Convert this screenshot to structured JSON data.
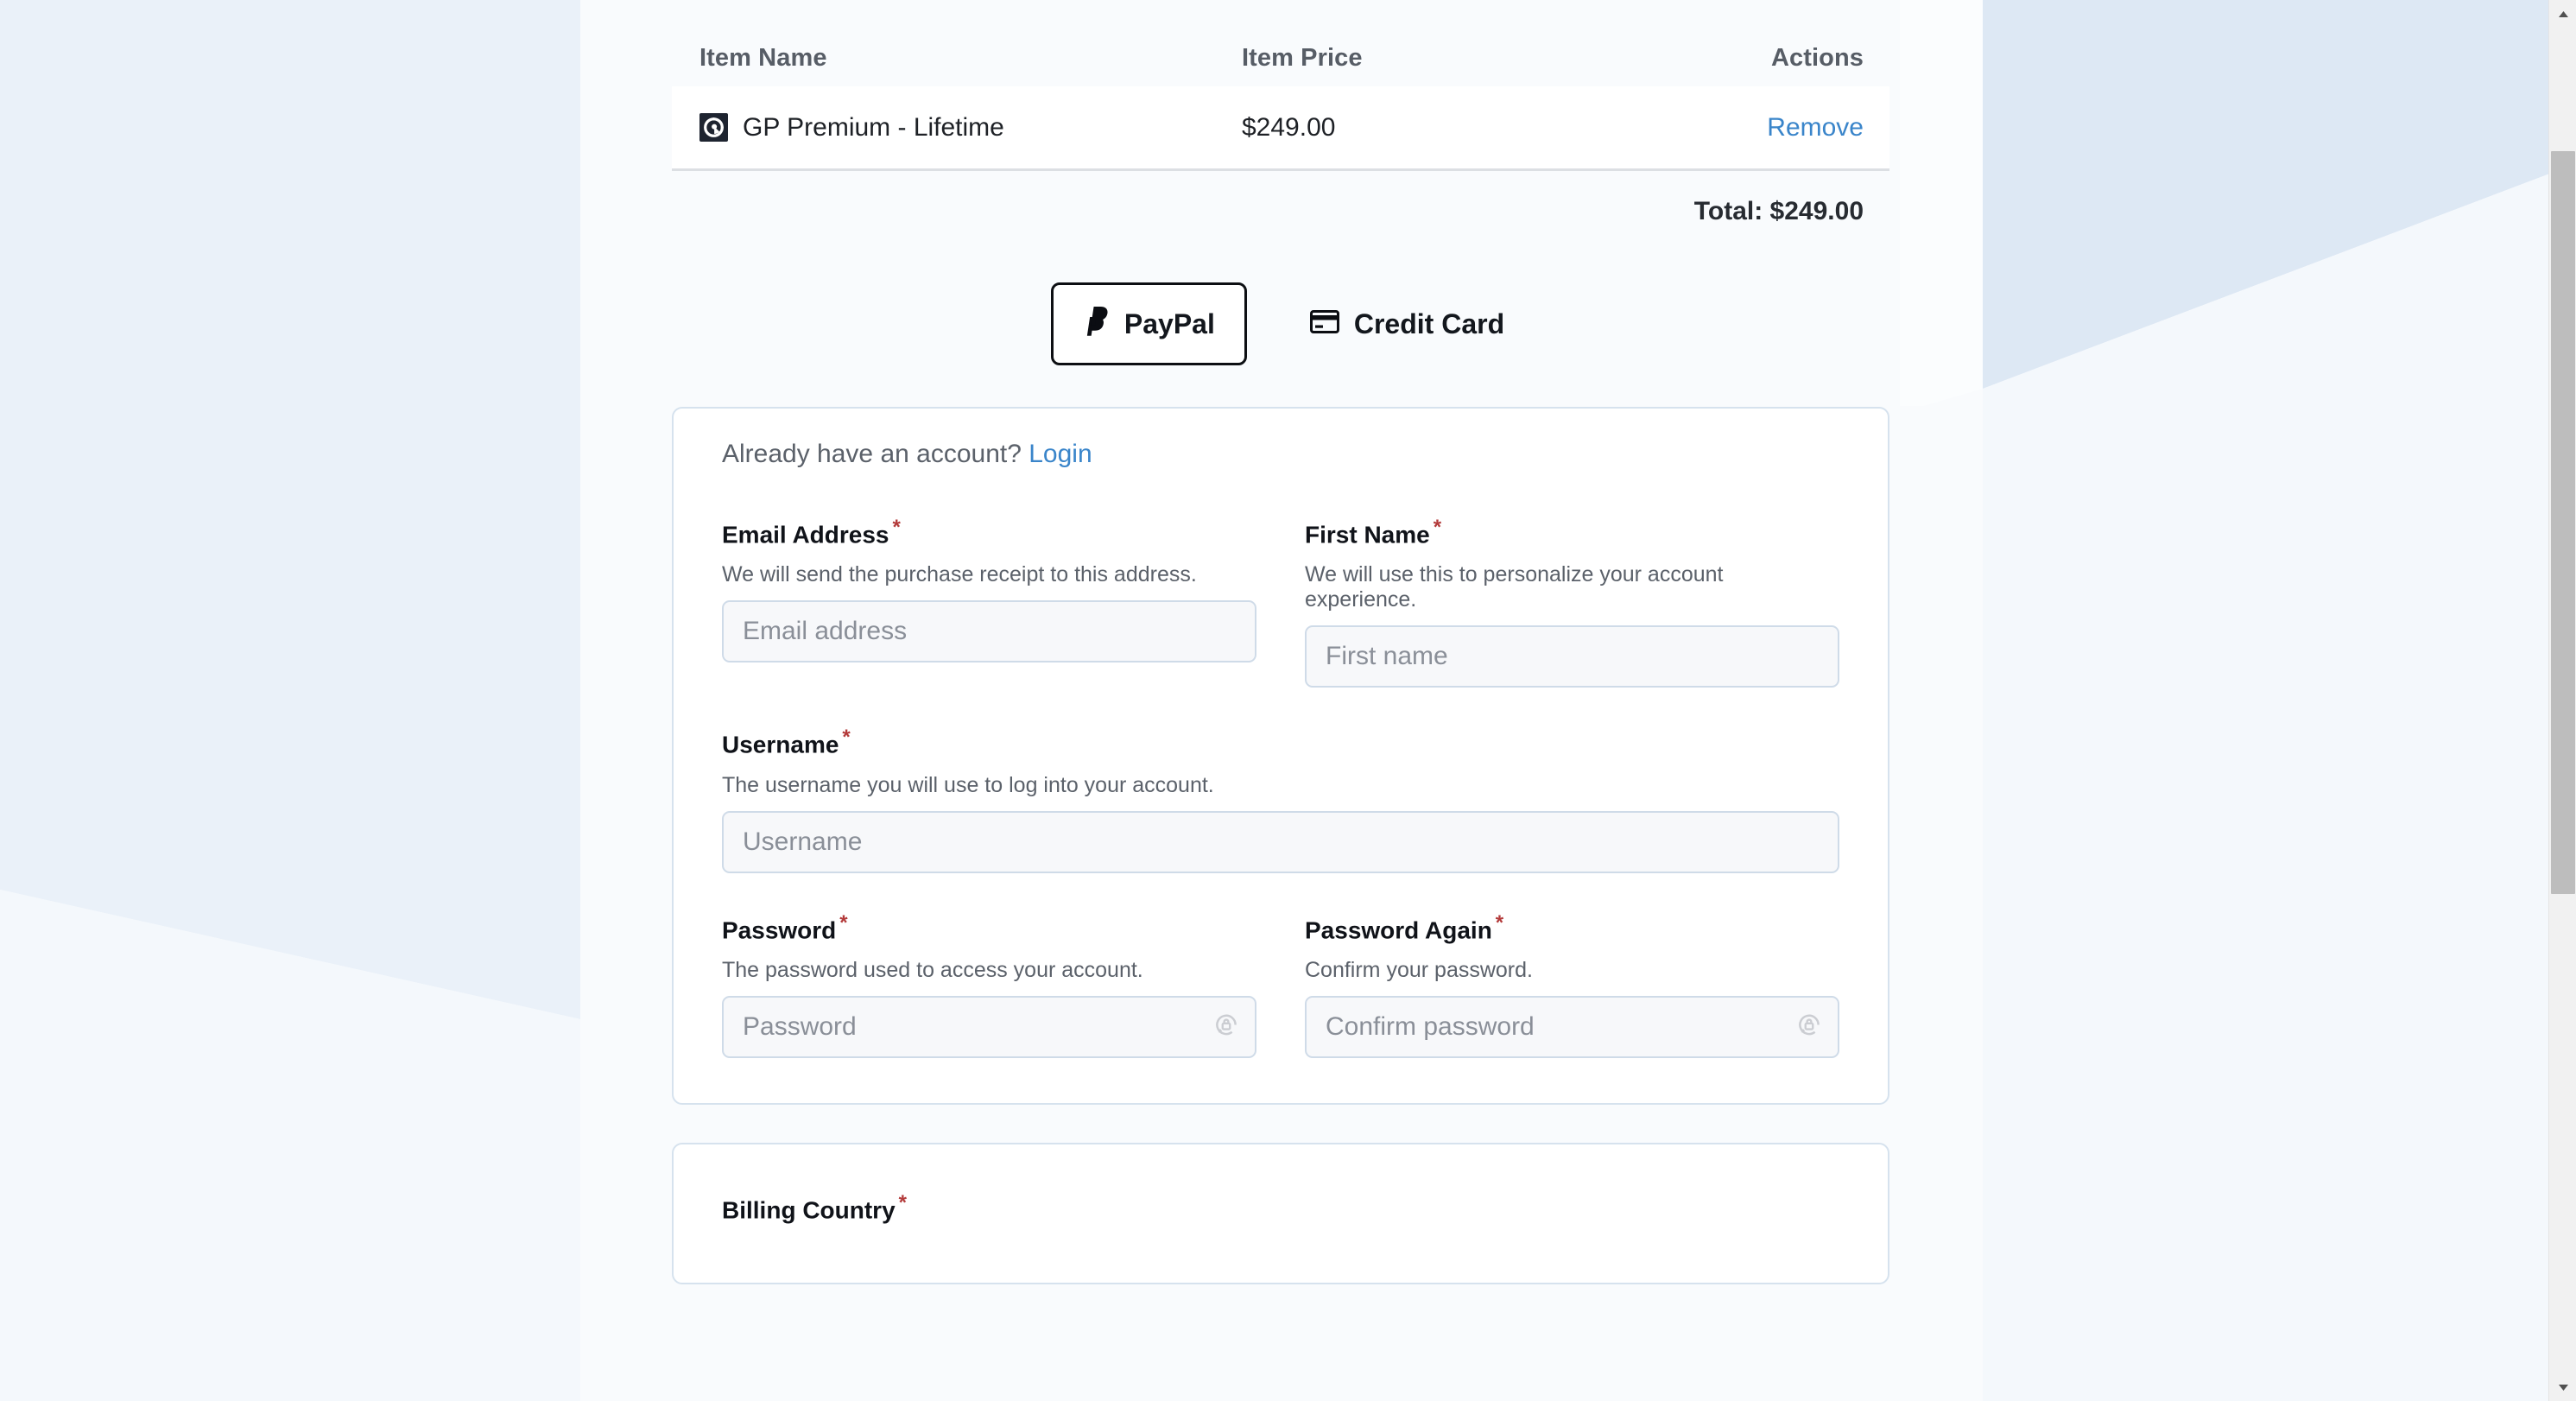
{
  "cart": {
    "columns": {
      "item_name": "Item Name",
      "item_price": "Item Price",
      "actions": "Actions"
    },
    "items": [
      {
        "logo_icon": "generatepress-logo-icon",
        "name": "GP Premium - Lifetime",
        "price": "$249.00",
        "remove_label": "Remove"
      }
    ],
    "total_label": "Total: $249.00"
  },
  "payment_methods": [
    {
      "id": "paypal",
      "label": "PayPal",
      "icon": "paypal-icon",
      "selected": true
    },
    {
      "id": "credit-card",
      "label": "Credit Card",
      "icon": "credit-card-icon",
      "selected": false
    }
  ],
  "account": {
    "have_account_text": "Already have an account?",
    "login_link": "Login",
    "fields": [
      {
        "id": "email",
        "label": "Email Address",
        "required_mark": "*",
        "help": "We will send the purchase receipt to this address.",
        "placeholder": "Email address",
        "value": "",
        "has_password_icon": false
      },
      {
        "id": "first-name",
        "label": "First Name",
        "required_mark": "*",
        "help": "We will use this to personalize your account experience.",
        "placeholder": "First name",
        "value": "",
        "has_password_icon": false
      },
      {
        "id": "username",
        "label": "Username",
        "required_mark": "*",
        "help": "The username you will use to log into your account.",
        "placeholder": "Username",
        "value": "",
        "has_password_icon": false
      },
      {
        "id": "password",
        "label": "Password",
        "required_mark": "*",
        "help": "The password used to access your account.",
        "placeholder": "Password",
        "value": "",
        "has_password_icon": true
      },
      {
        "id": "password-again",
        "label": "Password Again",
        "required_mark": "*",
        "help": "Confirm your password.",
        "placeholder": "Confirm password",
        "value": "",
        "has_password_icon": true
      }
    ]
  },
  "billing": {
    "label": "Billing Country",
    "required_mark": "*"
  },
  "colors": {
    "link": "#3a85ca",
    "required_asterisk": "#b33a3a",
    "selected_border": "#0d0f13",
    "card_border": "#d6e2ee",
    "page_background": "#f9fbfd",
    "accent_pale_blue": "#dde8f4",
    "logo_background": "#1e2430"
  },
  "scrollbar": {
    "orientation": "vertical",
    "up_arrow": "▲",
    "down_arrow": "▼"
  }
}
